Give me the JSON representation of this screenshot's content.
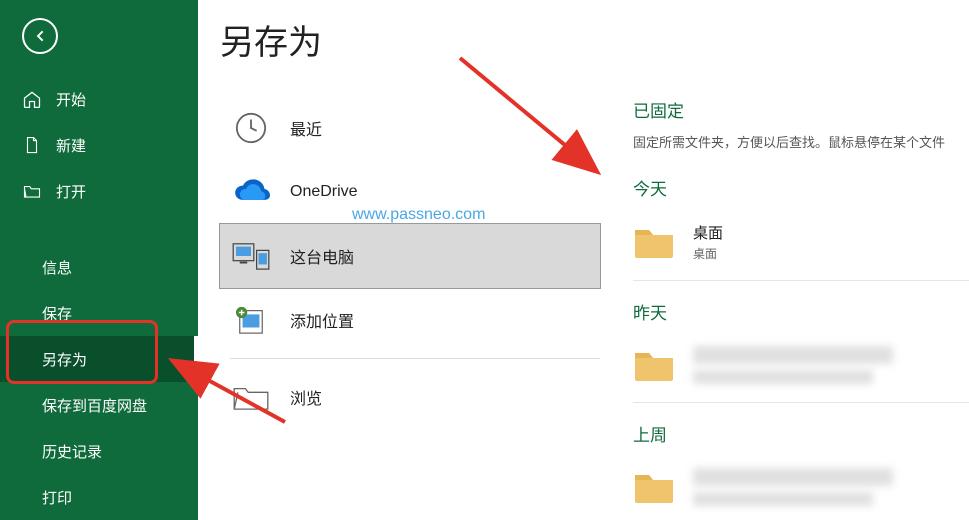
{
  "page_title": "另存为",
  "watermark": "www.passneo.com",
  "sidebar": {
    "items": [
      {
        "label": "开始",
        "icon": "home-icon",
        "has_icon": true
      },
      {
        "label": "新建",
        "icon": "document-icon",
        "has_icon": true
      },
      {
        "label": "打开",
        "icon": "folder-open-icon",
        "has_icon": true
      },
      {
        "label": "信息",
        "has_icon": false
      },
      {
        "label": "保存",
        "has_icon": false
      },
      {
        "label": "另存为",
        "has_icon": false,
        "selected": true
      },
      {
        "label": "保存到百度网盘",
        "has_icon": false
      },
      {
        "label": "历史记录",
        "has_icon": false
      },
      {
        "label": "打印",
        "has_icon": false
      }
    ]
  },
  "locations": {
    "items": [
      {
        "label": "最近",
        "icon": "clock-icon"
      },
      {
        "label": "OneDrive",
        "icon": "cloud-icon"
      },
      {
        "label": "这台电脑",
        "icon": "pc-icon",
        "selected": true
      },
      {
        "label": "添加位置",
        "icon": "add-location-icon"
      },
      {
        "label": "浏览",
        "icon": "browse-icon"
      }
    ]
  },
  "pinned": {
    "title": "已固定",
    "subtitle": "固定所需文件夹，方便以后查找。鼠标悬停在某个文件"
  },
  "groups": [
    {
      "heading": "今天",
      "folders": [
        {
          "name": "桌面",
          "path": "桌面",
          "blurred": false
        }
      ]
    },
    {
      "heading": "昨天",
      "folders": [
        {
          "name": "██████",
          "path": "桌面 » ████",
          "blurred": true
        }
      ]
    },
    {
      "heading": "上周",
      "folders": [
        {
          "name": "██████",
          "path": "████",
          "blurred": true
        }
      ]
    }
  ]
}
